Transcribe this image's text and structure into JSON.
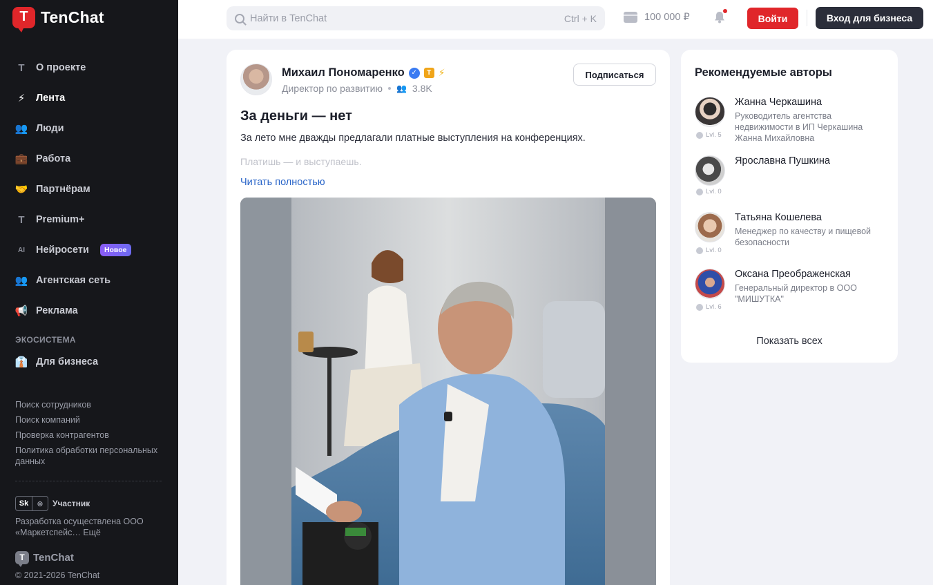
{
  "app": {
    "name": "TenChat",
    "logo_letter": "T"
  },
  "sidebar": {
    "items": [
      {
        "label": "О проекте",
        "icon": "tenchat-icon",
        "glyph": "T"
      },
      {
        "label": "Лента",
        "icon": "bolt-icon",
        "glyph": "⚡"
      },
      {
        "label": "Люди",
        "icon": "people-icon",
        "glyph": "👥"
      },
      {
        "label": "Работа",
        "icon": "briefcase-icon",
        "glyph": "💼"
      },
      {
        "label": "Партнёрам",
        "icon": "handshake-icon",
        "glyph": "🤝"
      },
      {
        "label": "Premium+",
        "icon": "premium-icon",
        "glyph": "T"
      },
      {
        "label": "Нейросети",
        "icon": "ai-icon",
        "glyph": "AI",
        "badge": "Новое"
      },
      {
        "label": "Агентская сеть",
        "icon": "network-icon",
        "glyph": "👥"
      },
      {
        "label": "Реклама",
        "icon": "megaphone-icon",
        "glyph": "📢"
      }
    ],
    "ecosystem_label": "ЭКОСИСТЕМА",
    "business": {
      "label": "Для бизнеса",
      "icon": "business-icon",
      "glyph": "👔"
    },
    "footer_links": [
      "Поиск сотрудников",
      "Поиск компаний",
      "Проверка контрагентов",
      "Политика обработки персональных данных"
    ],
    "sk_badge": "Sk",
    "sk_label": "Участник",
    "developer_text": "Разработка осуществлена ООО «Маркетспейс… Ещё",
    "footer_logo_text": "TenChat",
    "copyright": "© 2021-2026 TenChat"
  },
  "header": {
    "search_placeholder": "Найти в TenChat",
    "search_shortcut": "Ctrl + K",
    "balance": "100 000 ₽",
    "login_label": "Войти",
    "business_login_label": "Вход для бизнеса"
  },
  "post": {
    "author": "Михаил Пономаренко",
    "position": "Директор по развитию",
    "followers": "3.8K",
    "subscribe_label": "Подписаться",
    "title": "За деньги — нет",
    "paragraph1": "За лето мне дважды предлагали платные выступления на конференциях.",
    "paragraph2": "Платишь — и выступаешь.",
    "read_more": "Читать полностью"
  },
  "recommended": {
    "title": "Рекомендуемые авторы",
    "authors": [
      {
        "name": "Жанна Черкашина",
        "role": "Руководитель агентства недвижимости в ИП Черкашина Жанна Михайловна",
        "level": "Lvl. 5"
      },
      {
        "name": "Ярославна Пушкина",
        "role": "",
        "level": "Lvl. 0"
      },
      {
        "name": "Татьяна Кошелева",
        "role": "Менеджер по качеству и пищевой безопасности",
        "level": "Lvl. 0"
      },
      {
        "name": "Оксана Преображенская",
        "role": "Генеральный директор в ООО \"МИШУТКА\"",
        "level": "Lvl. 6"
      }
    ],
    "show_all": "Показать всех"
  },
  "colors": {
    "brand": "#e0262a",
    "sidebar_bg": "#16171b",
    "link": "#2864c8",
    "page_bg": "#f1f2f7"
  }
}
